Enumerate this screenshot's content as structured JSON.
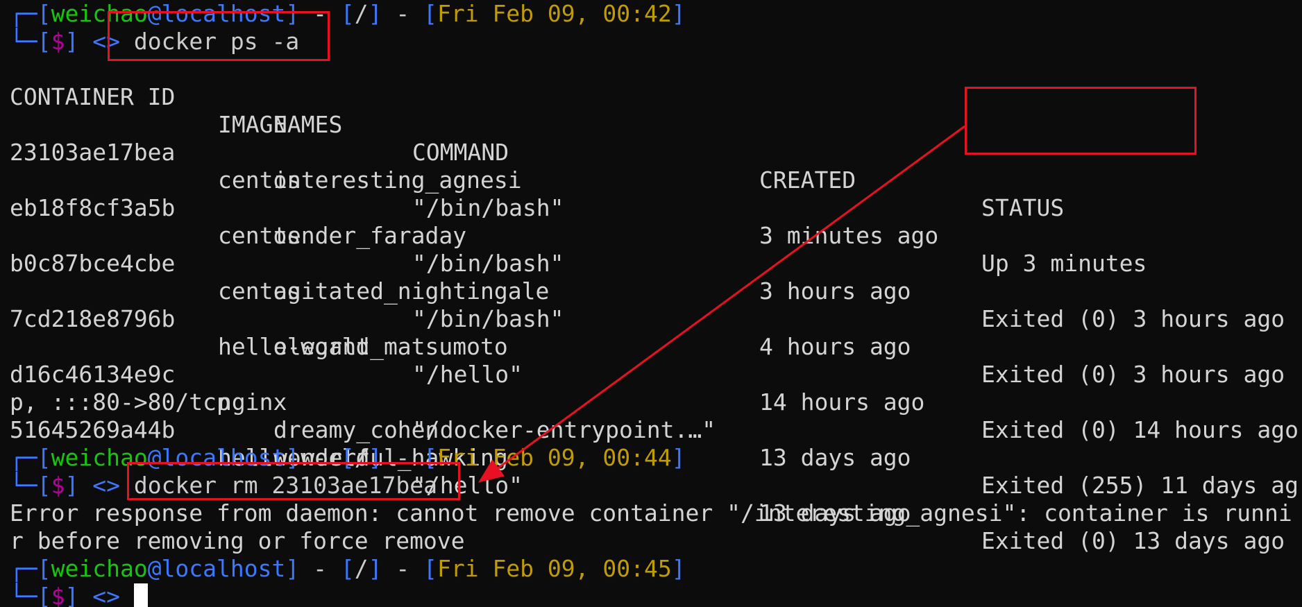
{
  "prompts": [
    {
      "user": "weichao",
      "host": "localhost",
      "path": "/",
      "datetime": "Fri Feb 09, 00:42",
      "symbol": "$",
      "arrows": "<>",
      "command": "docker ps -a"
    },
    {
      "user": "weichao",
      "host": "localhost",
      "path": "/",
      "datetime": "Fri Feb 09, 00:44",
      "symbol": "$",
      "arrows": "<>",
      "command": "docker rm 23103ae17bea"
    },
    {
      "user": "weichao",
      "host": "localhost",
      "path": "/",
      "datetime": "Fri Feb 09, 00:45",
      "symbol": "$",
      "arrows": "<>",
      "command": ""
    }
  ],
  "table": {
    "headers": {
      "container_id": "CONTAINER ID",
      "image": "IMAGE",
      "command": "COMMAND",
      "created": "CREATED",
      "status": "STATUS",
      "names": "NAMES"
    },
    "rows": [
      {
        "container_id": "23103ae17bea",
        "image": "centos",
        "command": "\"/bin/bash\"",
        "created": "3 minutes ago",
        "status": "Up 3 minutes",
        "ports": "",
        "names": "interesting_agnesi"
      },
      {
        "container_id": "eb18f8cf3a5b",
        "image": "centos",
        "command": "\"/bin/bash\"",
        "created": "3 hours ago",
        "status": "Exited (0) 3 hours ago",
        "ports": "",
        "names": "tender_faraday"
      },
      {
        "container_id": "b0c87bce4cbe",
        "image": "centos",
        "command": "\"/bin/bash\"",
        "created": "4 hours ago",
        "status": "Exited (0) 3 hours ago",
        "ports": "",
        "names": "agitated_nightingale"
      },
      {
        "container_id": "7cd218e8796b",
        "image": "hello-world",
        "command": "\"/hello\"",
        "created": "14 hours ago",
        "status": "Exited (0) 14 hours ago",
        "ports": "",
        "names": "elegant_matsumoto"
      },
      {
        "container_id": "d16c46134e9c",
        "image": "nginx",
        "command": "\"/docker-entrypoint.…\"",
        "created": "13 days ago",
        "status": "Exited (255) 11 days ag",
        "ports": "p, :::80->80/tcp",
        "names": "dreamy_cohen"
      },
      {
        "container_id": "51645269a44b",
        "image": "hello-world",
        "command": "\"/hello\"",
        "created": "13 days ago",
        "status": "Exited (0) 13 days ago",
        "ports": "",
        "names": "wonderful_hawking"
      }
    ]
  },
  "error": {
    "line1": "Error response from daemon: cannot remove container \"/interesting_agnesi\": container is runni",
    "line2": "r before removing or force remove"
  },
  "colors": {
    "background": "#0c0c0c",
    "bracket": "#3b78ff",
    "user": "#16c60c",
    "host": "#3b78ff",
    "dollar": "#b4009e",
    "datetime": "#c19c00",
    "annotation": "#e81123"
  }
}
